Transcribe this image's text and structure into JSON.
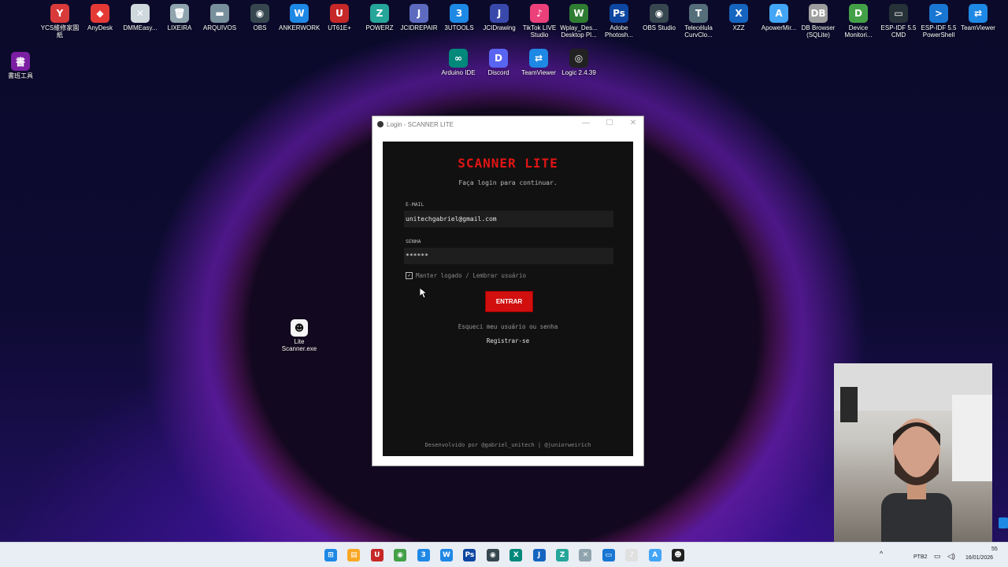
{
  "desktop": {
    "icons": [
      {
        "label": "YCS維修家園\n紙",
        "color": "#d83a3a",
        "glyph": "Y"
      },
      {
        "label": "AnyDesk",
        "color": "#e53935",
        "glyph": "◆"
      },
      {
        "label": "DMMEasy...",
        "color": "#cfd8dc",
        "glyph": "✕"
      },
      {
        "label": "LIXEIRA",
        "color": "#90a4ae",
        "glyph": "🗑"
      },
      {
        "label": "ARQUIVOS",
        "color": "#78909c",
        "glyph": "▬"
      },
      {
        "label": "OBS",
        "color": "#37474f",
        "glyph": "◉"
      },
      {
        "label": "ANKERWORK",
        "color": "#1e88e5",
        "glyph": "W"
      },
      {
        "label": "UT61E+",
        "color": "#c62828",
        "glyph": "U"
      },
      {
        "label": "POWERZ",
        "color": "#26a69a",
        "glyph": "Z"
      },
      {
        "label": "JCIDREPAIR",
        "color": "#5c6bc0",
        "glyph": "J"
      },
      {
        "label": "3UTOOLS",
        "color": "#1e88e5",
        "glyph": "3"
      },
      {
        "label": "JCIDrawing",
        "color": "#3949ab",
        "glyph": "J"
      },
      {
        "label": "TikTok LIVE\nStudio",
        "color": "#ec407a",
        "glyph": "♪"
      },
      {
        "label": "Wplay_Des...\nDesktop Pl...",
        "color": "#2e7d32",
        "glyph": "W"
      },
      {
        "label": "Adobe\nPhotosh...",
        "color": "#0d47a1",
        "glyph": "Ps"
      },
      {
        "label": "OBS Studio",
        "color": "#37474f",
        "glyph": "◉"
      },
      {
        "label": "Telecélula\nCurvClo...",
        "color": "#546e7a",
        "glyph": "T"
      },
      {
        "label": "XZZ",
        "color": "#1565c0",
        "glyph": "X"
      },
      {
        "label": "ApowerMir...",
        "color": "#42a5f5",
        "glyph": "A"
      },
      {
        "label": "DB Browser\n(SQLite)",
        "color": "#9e9e9e",
        "glyph": "DB"
      },
      {
        "label": "Device\nMonitori...",
        "color": "#43a047",
        "glyph": "D"
      },
      {
        "label": "ESP-IDF 5.5\nCMD",
        "color": "#263238",
        "glyph": "▭"
      },
      {
        "label": "ESP-IDF 5.5\nPowerShell",
        "color": "#1976d2",
        "glyph": ">"
      },
      {
        "label": "TeamViewer",
        "color": "#1e88e5",
        "glyph": "⇄"
      }
    ],
    "icons_row2": [
      {
        "label": "Arduino IDE",
        "color": "#00897b",
        "glyph": "∞"
      },
      {
        "label": "Discord",
        "color": "#5865f2",
        "glyph": "D"
      },
      {
        "label": "TeamViewer",
        "color": "#1e88e5",
        "glyph": "⇄"
      },
      {
        "label": "Logic 2.4.39",
        "color": "#212121",
        "glyph": "◎"
      }
    ],
    "left_icon": {
      "label": "書班工具",
      "color": "#7b1fa2",
      "glyph": "書"
    },
    "file_icon": {
      "label": "Lite\nScanner.exe",
      "color": "#f5f5f5",
      "glyph": "☻"
    }
  },
  "window": {
    "title": "Login - SCANNER LITE",
    "brand": "SCANNER LITE",
    "subtitle": "Faça login para continuar.",
    "email_label": "E-MAIL",
    "email_value": "unitechgabriel@gmail.com",
    "password_label": "SENHA",
    "password_value": "******",
    "remember_label": "Manter logado / Lembrar usuário",
    "remember_checked": true,
    "enter_button": "ENTRAR",
    "forgot_link": "Esqueci meu usuário ou senha",
    "register_link": "Registrar-se",
    "footer": "Desenvolvido por @gabriel_unitech | @juniorweirich",
    "accent_color": "#d10f0f"
  },
  "taskbar": {
    "apps": [
      {
        "name": "windows-start",
        "color": "#1e88e5",
        "glyph": "⊞"
      },
      {
        "name": "file-explorer",
        "color": "#f9a825",
        "glyph": "▤"
      },
      {
        "name": "unit-app",
        "color": "#c62828",
        "glyph": "U"
      },
      {
        "name": "chrome",
        "color": "#43a047",
        "glyph": "◉"
      },
      {
        "name": "3utools",
        "color": "#1e88e5",
        "glyph": "3"
      },
      {
        "name": "ankerwork",
        "color": "#1e88e5",
        "glyph": "W"
      },
      {
        "name": "photoshop",
        "color": "#0d47a1",
        "glyph": "Ps"
      },
      {
        "name": "obs",
        "color": "#37474f",
        "glyph": "◉"
      },
      {
        "name": "xzz",
        "color": "#00897b",
        "glyph": "X"
      },
      {
        "name": "jcid",
        "color": "#1565c0",
        "glyph": "J"
      },
      {
        "name": "powerz",
        "color": "#26a69a",
        "glyph": "Z"
      },
      {
        "name": "dmm",
        "color": "#90a4ae",
        "glyph": "✕"
      },
      {
        "name": "remote-desktop",
        "color": "#1976d2",
        "glyph": "▭"
      },
      {
        "name": "music",
        "color": "#e0e0e0",
        "glyph": "♪"
      },
      {
        "name": "apowermirror",
        "color": "#42a5f5",
        "glyph": "A"
      },
      {
        "name": "scanner",
        "color": "#212121",
        "glyph": "☻"
      }
    ],
    "lang": "PTB2",
    "time": "55",
    "date": "16/01/2026"
  }
}
